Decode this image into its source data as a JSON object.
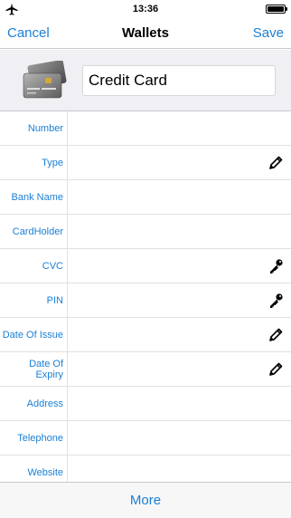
{
  "status_bar": {
    "time": "13:36",
    "airplane_icon": "airplane-icon",
    "battery_icon": "battery-icon"
  },
  "nav": {
    "cancel_label": "Cancel",
    "title": "Wallets",
    "save_label": "Save"
  },
  "header": {
    "card_icon": "credit-card-icon",
    "name_value": "Credit Card"
  },
  "fields": [
    {
      "label": "Number",
      "action_icon": ""
    },
    {
      "label": "Type",
      "action_icon": "pencil-icon"
    },
    {
      "label": "Bank Name",
      "action_icon": ""
    },
    {
      "label": "CardHolder",
      "action_icon": ""
    },
    {
      "label": "CVC",
      "action_icon": "key-icon"
    },
    {
      "label": "PIN",
      "action_icon": "key-icon"
    },
    {
      "label": "Date Of Issue",
      "action_icon": "pencil-icon"
    },
    {
      "label": "Date Of Expiry",
      "action_icon": "pencil-icon"
    },
    {
      "label": "Address",
      "action_icon": ""
    },
    {
      "label": "Telephone",
      "action_icon": ""
    },
    {
      "label": "Website",
      "action_icon": ""
    }
  ],
  "tab_bar": {
    "more_label": "More"
  },
  "colors": {
    "accent": "#1a7fd6",
    "header_bg": "#efeff4",
    "separator": "#e0e0e4"
  }
}
